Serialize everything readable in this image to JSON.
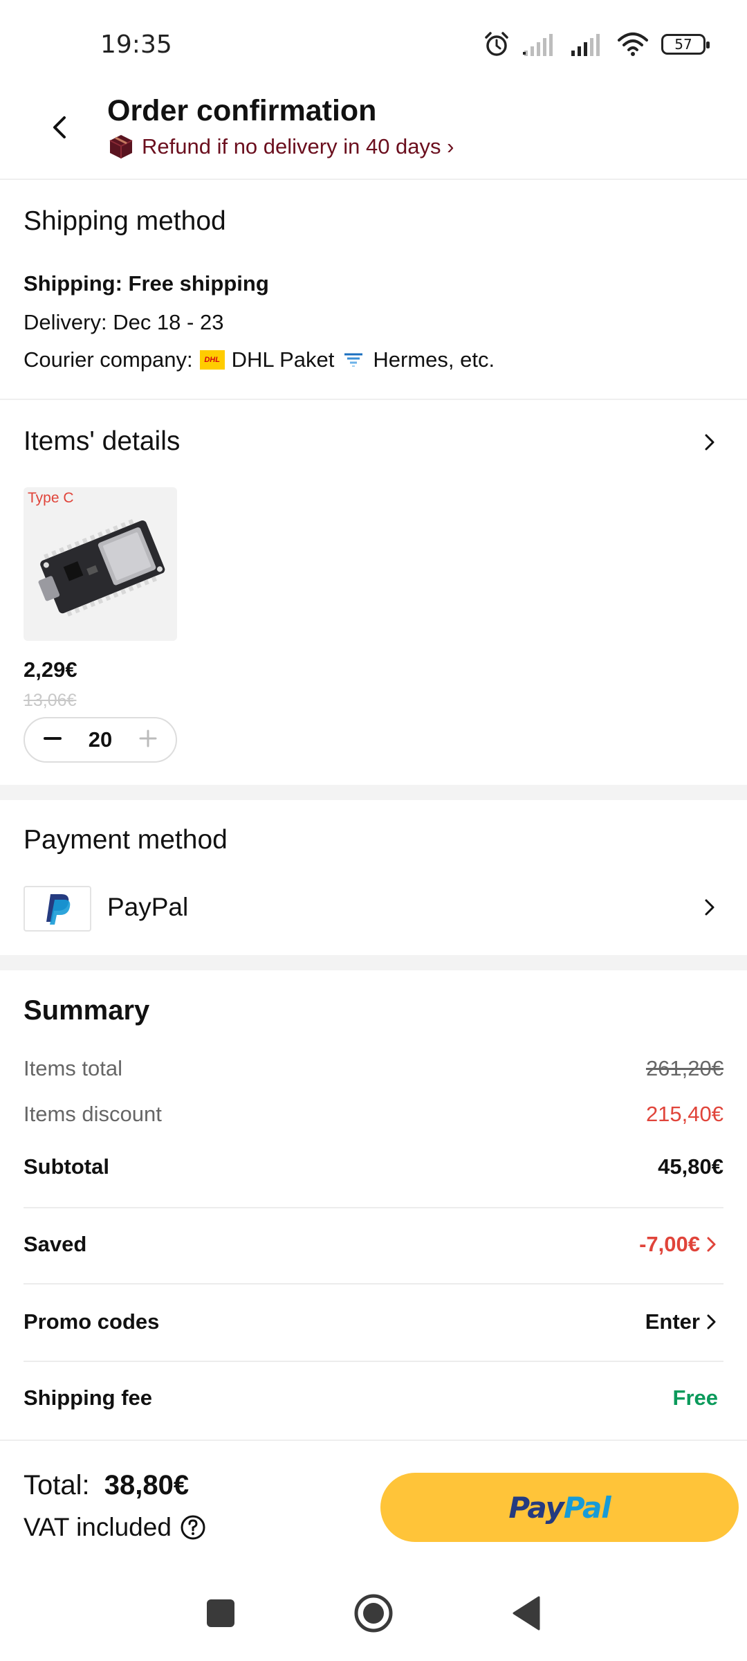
{
  "status_bar": {
    "time": "19:35",
    "battery": "57"
  },
  "header": {
    "title": "Order confirmation",
    "refund_text": "Refund if no delivery in 40 days ›"
  },
  "shipping": {
    "title": "Shipping method",
    "shipping_line": "Shipping: Free shipping",
    "delivery_line": "Delivery: Dec 18 - 23",
    "courier_label": "Courier company:",
    "courier_1": "DHL Paket",
    "courier_2": "Hermes, etc."
  },
  "items": {
    "title": "Items' details",
    "product": {
      "tag": "Type C",
      "price": "2,29€",
      "old_price": "13,06€",
      "quantity": "20"
    }
  },
  "payment": {
    "title": "Payment method",
    "method": "PayPal"
  },
  "summary": {
    "title": "Summary",
    "items_total_label": "Items total",
    "items_total_value": "261,20€",
    "items_discount_label": "Items discount",
    "items_discount_value": "215,40€",
    "subtotal_label": "Subtotal",
    "subtotal_value": "45,80€",
    "saved_label": "Saved",
    "saved_value": "-7,00€",
    "promo_label": "Promo codes",
    "promo_value": "Enter",
    "shipping_fee_label": "Shipping fee",
    "shipping_fee_value": "Free"
  },
  "footer": {
    "total_label": "Total:",
    "total_value": "38,80€",
    "vat_text": "VAT included",
    "pay_button_part1": "Pay",
    "pay_button_part2": "Pal"
  },
  "colors": {
    "accent_red": "#e0443a",
    "refund_text": "#6b0f1e",
    "free_green": "#0b9a5b",
    "paypal_yellow": "#ffc439",
    "paypal_dark_blue": "#253b80",
    "paypal_light_blue": "#179bd7"
  },
  "icons": [
    "back-arrow-icon",
    "package-icon",
    "chevron-right-icon",
    "minus-icon",
    "plus-icon",
    "paypal-logo-icon",
    "info-icon",
    "alarm-icon",
    "signal-icon",
    "wifi-icon",
    "battery-icon",
    "nav-square-icon",
    "nav-home-icon",
    "nav-back-icon"
  ]
}
